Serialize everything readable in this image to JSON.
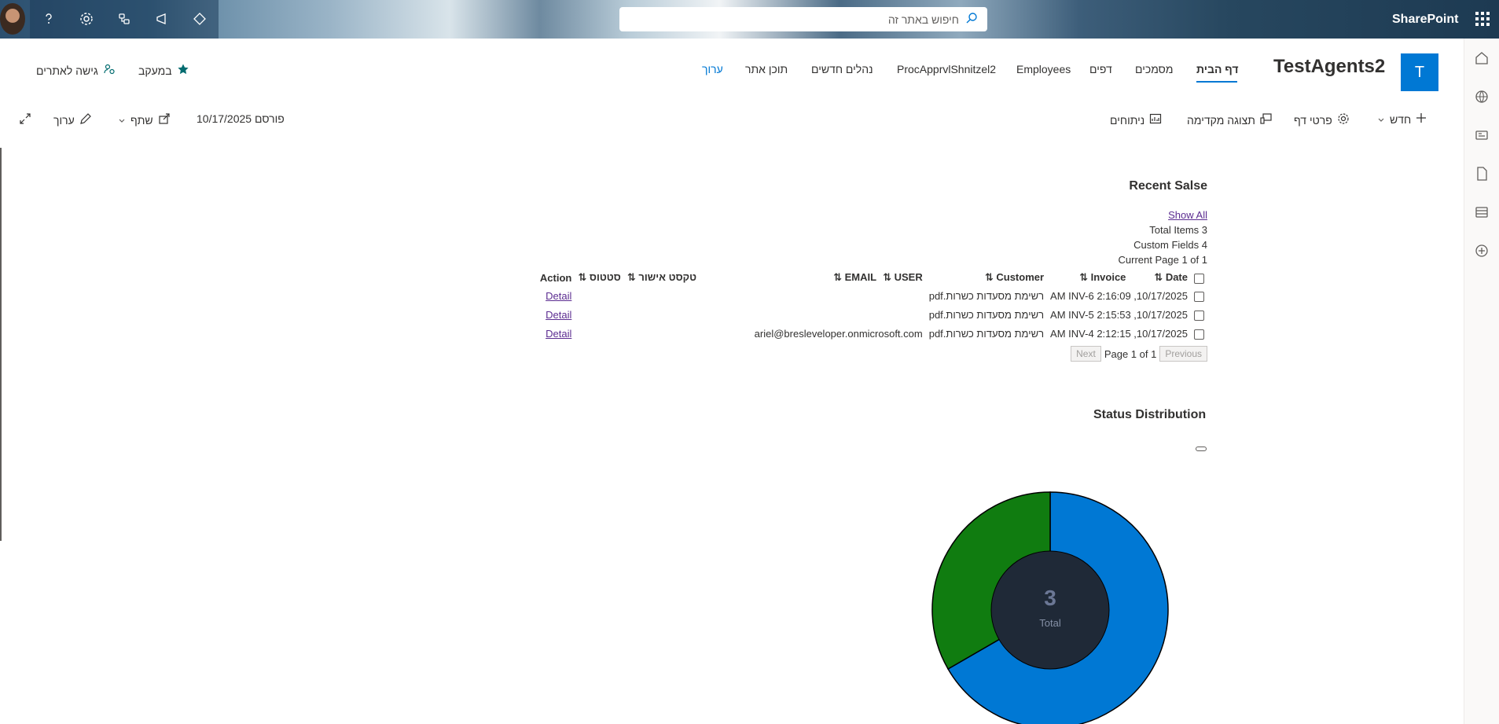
{
  "suitebar": {
    "search_placeholder": "חיפוש באתר זה",
    "brand": "SharePoint",
    "icons": [
      "avatar",
      "help-icon",
      "settings-icon",
      "share-icon",
      "megaphone-icon",
      "diamond-icon",
      "waffle-icon"
    ]
  },
  "site": {
    "logo_letter": "T",
    "title": "TestAgents2",
    "nav": [
      {
        "label": "דף הבית",
        "active": true
      },
      {
        "label": "מסמכים"
      },
      {
        "label": "דפים"
      },
      {
        "label": "Employees"
      },
      {
        "label": "ProcApprvlShnitzel2"
      },
      {
        "label": "נהלים חדשים"
      },
      {
        "label": "תוכן אתר"
      },
      {
        "label": "ערוך"
      }
    ],
    "follow_label": "במעקב",
    "site_access_label": "גישה לאתרים"
  },
  "commandbar": {
    "new_label": "חדש",
    "page_details_label": "פרטי דף",
    "preview_label": "תצוגה מקדימה",
    "analytics_label": "ניתוחים",
    "published": "פורסם 10/17/2025",
    "share_label": "שתף",
    "edit_label": "ערוך"
  },
  "recent_sales": {
    "title": "Recent Salse",
    "show_all": "Show All",
    "total_items": "Total Items 3",
    "custom_fields": "Custom Fields 4",
    "current_page": "Current Page 1 of 1",
    "columns": [
      "Date ⇅",
      "Invoice ⇅",
      "Customer ⇅",
      "USER ⇅",
      "EMAIL ⇅",
      "טקסט אישור ⇅",
      "סטטוס ⇅",
      "Action"
    ],
    "rows": [
      {
        "date": "10/17/2025, 2:16:09 AM",
        "invoice": "INV-6",
        "customer": "רשימת מסעדות כשרות.pdf",
        "email": "",
        "action": "Detail"
      },
      {
        "date": "10/17/2025, 2:15:53 AM",
        "invoice": "INV-5",
        "customer": "רשימת מסעדות כשרות.pdf",
        "email": "",
        "action": "Detail"
      },
      {
        "date": "10/17/2025, 2:12:15 AM",
        "invoice": "INV-4",
        "customer": "רשימת מסעדות כשרות.pdf",
        "email": "ariel@bresleveloper.onmicrosoft.com",
        "action": "Detail"
      }
    ],
    "pager": {
      "previous": "Previous",
      "page_text": "Page 1 of 1",
      "next": "Next"
    }
  },
  "status_distribution": {
    "title": "Status Distribution",
    "center_value": "3",
    "center_label": "Total"
  },
  "chart_data": {
    "type": "pie",
    "slices": [
      {
        "value": 2,
        "color": "#0078d4"
      },
      {
        "value": 1,
        "color": "#107c10"
      }
    ],
    "total": 3
  }
}
